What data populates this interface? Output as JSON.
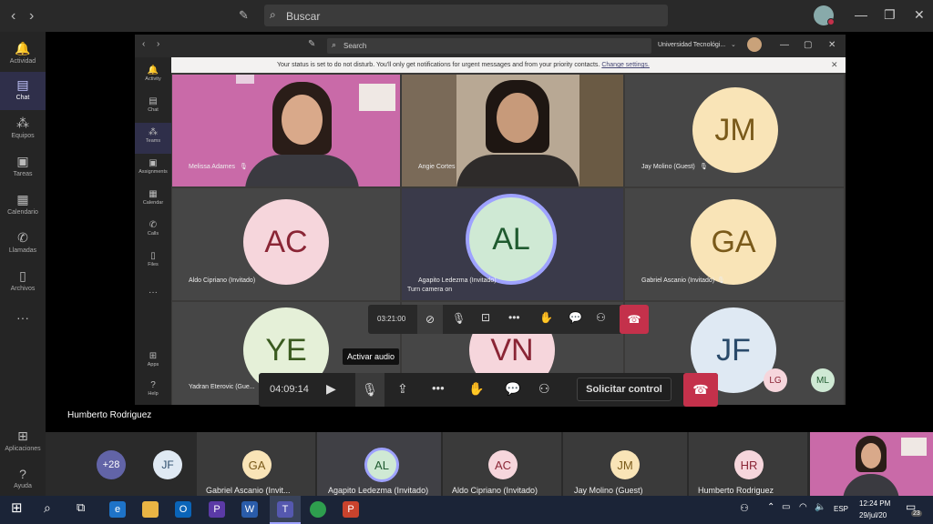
{
  "outer_window": {
    "search_placeholder": "Buscar",
    "rail": [
      {
        "label": "Actividad",
        "icon": "bell-icon"
      },
      {
        "label": "Chat",
        "icon": "chat-icon"
      },
      {
        "label": "Equipos",
        "icon": "teams-icon"
      },
      {
        "label": "Tareas",
        "icon": "assignments-icon"
      },
      {
        "label": "Calendario",
        "icon": "calendar-icon"
      },
      {
        "label": "Llamadas",
        "icon": "phone-icon"
      },
      {
        "label": "Archivos",
        "icon": "files-icon"
      },
      {
        "label": "Aplicaciones",
        "icon": "apps-icon"
      },
      {
        "label": "Ayuda",
        "icon": "help-icon"
      }
    ],
    "presenter_name": "Humberto Rodriguez"
  },
  "inner_window": {
    "search_placeholder": "Search",
    "org_name": "Universidad Tecnológi...",
    "rail": [
      {
        "label": "Activity",
        "icon": "bell-icon"
      },
      {
        "label": "Chat",
        "icon": "chat-icon"
      },
      {
        "label": "Teams",
        "icon": "teams-icon"
      },
      {
        "label": "Assignments",
        "icon": "assignments-icon"
      },
      {
        "label": "Calendar",
        "icon": "calendar-icon"
      },
      {
        "label": "Calls",
        "icon": "phone-icon"
      },
      {
        "label": "Files",
        "icon": "files-icon"
      },
      {
        "label": "Apps",
        "icon": "apps-icon"
      },
      {
        "label": "Help",
        "icon": "help-icon"
      }
    ],
    "notice_text": "Your status is set to do not disturb. You'll only get notifications for urgent messages and from your priority contacts.",
    "notice_link": "Change settings."
  },
  "tiles": [
    {
      "name": "Melissa Adames",
      "initials": ""
    },
    {
      "name": "Angie Cortes",
      "initials": ""
    },
    {
      "name": "Jay Molino (Guest)",
      "initials": "JM",
      "color": "#f9e4b7",
      "text_color": "#7a5a1a"
    },
    {
      "name": "Aldo Cipriano (Invitado)",
      "initials": "AC",
      "color": "#f6d6dc",
      "text_color": "#8a2535"
    },
    {
      "name": "Agapito Ledezma (Invitado)",
      "initials": "AL",
      "color": "#cfe9d4",
      "text_color": "#1f5a2f"
    },
    {
      "name": "Gabriel Ascanio (Invitado)",
      "initials": "GA",
      "color": "#f9e4b7",
      "text_color": "#7a5a1a"
    },
    {
      "name": "Yadran Eterovic (Gue...",
      "initials": "YE",
      "color": "#e5f0d8",
      "text_color": "#3a5a1f"
    },
    {
      "name": "",
      "initials": "VN",
      "color": "#f6d6dc",
      "text_color": "#8a2535"
    },
    {
      "name": "",
      "initials": "JF",
      "color": "#dfe9f3",
      "text_color": "#2a4a6a"
    }
  ],
  "inner_controls": {
    "timer": "03:21:00",
    "tooltip": "Turn camera on"
  },
  "outer_controls": {
    "timer": "04:09:14",
    "tooltip": "Activar audio",
    "control_button": "Solicitar control"
  },
  "stage_avatars": [
    {
      "initials": "LG",
      "color": "#f6d6dc",
      "text_color": "#8a2535"
    },
    {
      "initials": "ML",
      "color": "#cfe9d4",
      "text_color": "#1f5a2f"
    }
  ],
  "strip": {
    "more_count": "+28",
    "jf_initials": "JF",
    "items": [
      {
        "name": "Gabriel Ascanio (Invit...",
        "initials": "GA",
        "color": "#f9e4b7",
        "text_color": "#7a5a1a"
      },
      {
        "name": "Agapito Ledezma (Invitado)",
        "initials": "AL",
        "color": "#cfe9d4",
        "text_color": "#1f5a2f"
      },
      {
        "name": "Aldo Cipriano (Invitado)",
        "initials": "AC",
        "color": "#f6d6dc",
        "text_color": "#8a2535"
      },
      {
        "name": "Jay Molino (Guest)",
        "initials": "JM",
        "color": "#f9e4b7",
        "text_color": "#7a5a1a"
      },
      {
        "name": "Humberto Rodriguez",
        "initials": "HR",
        "color": "#f6d6dc",
        "text_color": "#8a2535"
      }
    ]
  },
  "taskbar": {
    "time": "12:24 PM",
    "date": "29/jul/20",
    "lang": "ESP",
    "notif_count": "23"
  },
  "colors": {
    "accent": "#6264a7",
    "end_call": "#c4314b"
  }
}
